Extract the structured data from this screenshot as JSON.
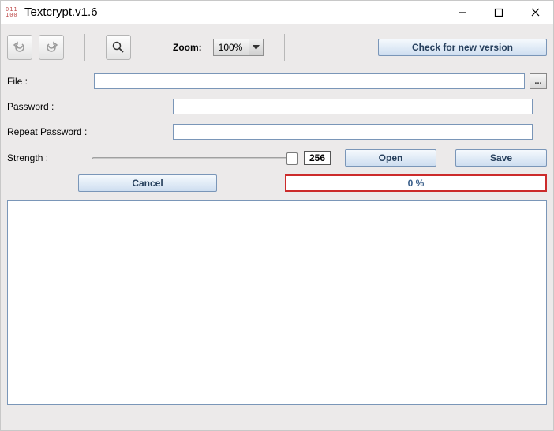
{
  "window": {
    "title": "Textcrypt.v1.6"
  },
  "toolbar": {
    "zoom_label": "Zoom:",
    "zoom_value": "100%",
    "check_label": "Check for new version"
  },
  "labels": {
    "file": "File :",
    "password": "Password :",
    "repeat": "Repeat Password :",
    "strength": "Strength :",
    "browse": "..."
  },
  "strength": {
    "value": "256"
  },
  "buttons": {
    "open": "Open",
    "save": "Save",
    "cancel": "Cancel"
  },
  "progress": {
    "text": "0 %"
  },
  "fields": {
    "file": "",
    "password": "",
    "repeat": ""
  }
}
